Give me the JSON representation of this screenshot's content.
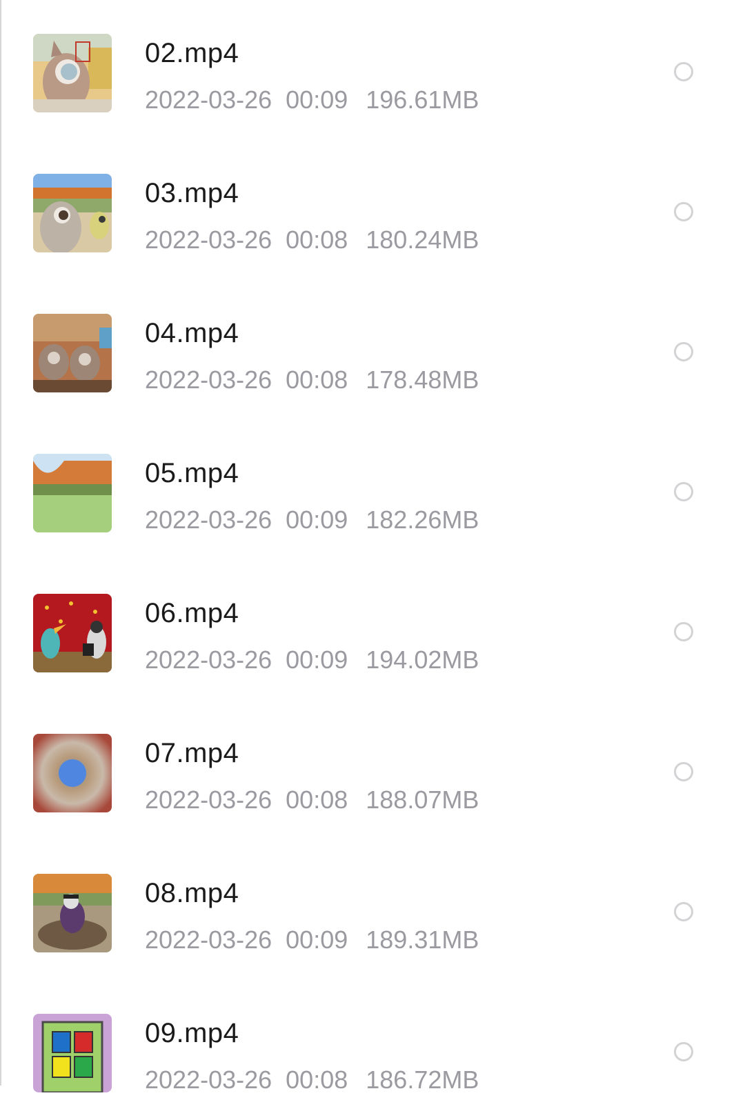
{
  "files": [
    {
      "name": "02.mp4",
      "date": "2022-03-26",
      "time": "00:09",
      "size": "196.61MB"
    },
    {
      "name": "03.mp4",
      "date": "2022-03-26",
      "time": "00:08",
      "size": "180.24MB"
    },
    {
      "name": "04.mp4",
      "date": "2022-03-26",
      "time": "00:08",
      "size": "178.48MB"
    },
    {
      "name": "05.mp4",
      "date": "2022-03-26",
      "time": "00:09",
      "size": "182.26MB"
    },
    {
      "name": "06.mp4",
      "date": "2022-03-26",
      "time": "00:09",
      "size": "194.02MB"
    },
    {
      "name": "07.mp4",
      "date": "2022-03-26",
      "time": "00:08",
      "size": "188.07MB"
    },
    {
      "name": "08.mp4",
      "date": "2022-03-26",
      "time": "00:09",
      "size": "189.31MB"
    },
    {
      "name": "09.mp4",
      "date": "2022-03-26",
      "time": "00:08",
      "size": "186.72MB"
    }
  ],
  "colors": {
    "filename": "#1a1a1a",
    "meta": "#9a9aa0",
    "radio_border": "#d3d3d6"
  }
}
